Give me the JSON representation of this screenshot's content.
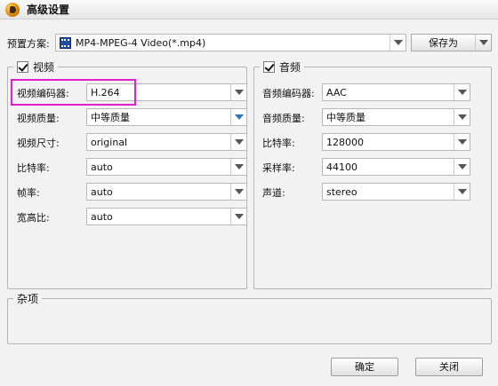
{
  "window": {
    "title": "高级设置",
    "icon": "app-logo-icon"
  },
  "preset": {
    "label": "预置方案:",
    "value": "MP4-MPEG-4 Video(*.mp4)",
    "icon": "video-file-icon",
    "save_as_label": "保存为"
  },
  "video": {
    "title": "视频",
    "enabled": true,
    "fields": [
      {
        "label": "视频编码器:",
        "value": "H.264"
      },
      {
        "label": "视频质量:",
        "value": "中等质量"
      },
      {
        "label": "视频尺寸:",
        "value": "original"
      },
      {
        "label": "比特率:",
        "value": "auto"
      },
      {
        "label": "帧率:",
        "value": "auto"
      },
      {
        "label": "宽高比:",
        "value": "auto"
      }
    ]
  },
  "audio": {
    "title": "音频",
    "enabled": true,
    "fields": [
      {
        "label": "音频编码器:",
        "value": "AAC"
      },
      {
        "label": "音频质量:",
        "value": "中等质量"
      },
      {
        "label": "比特率:",
        "value": "128000"
      },
      {
        "label": "采样率:",
        "value": "44100"
      },
      {
        "label": "声道:",
        "value": "stereo"
      }
    ]
  },
  "misc": {
    "title": "杂项"
  },
  "buttons": {
    "ok": "确定",
    "close": "关闭"
  },
  "colors": {
    "highlight": "#e020c8",
    "accent_arrow": "#2a73c9"
  }
}
